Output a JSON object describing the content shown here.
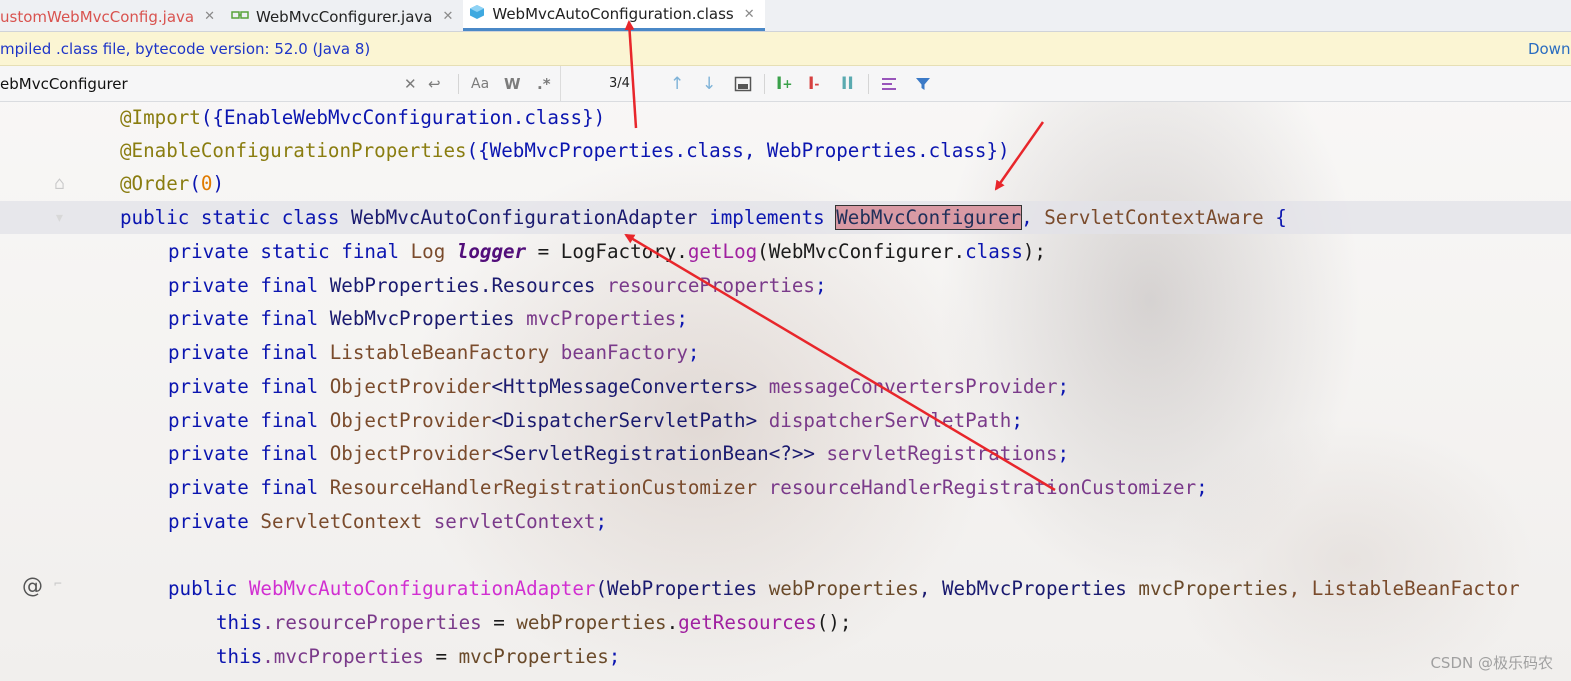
{
  "tabs": [
    {
      "label": "ustomWebMvcConfig.java",
      "color": "#d9534f",
      "icon": "java-file-icon",
      "active": false
    },
    {
      "label": "WebMvcConfigurer.java",
      "color": "#222222",
      "icon": "interface-file-icon",
      "active": false
    },
    {
      "label": "WebMvcAutoConfiguration.class",
      "color": "#222222",
      "icon": "class-file-icon",
      "active": true
    }
  ],
  "tab_close_glyph": "✕",
  "banner": {
    "message": "mpiled .class file, bytecode version: 52.0 (Java 8)",
    "download_label": "Downloa"
  },
  "search": {
    "query": "ebMvcConfigurer",
    "match_case": "Aa",
    "words": "W",
    "regex": ".*",
    "match_count": "3/4"
  },
  "code": {
    "l1_import": "@Import",
    "l1_args": "({EnableWebMvcConfiguration.",
    "l1_class": "class",
    "l1_end": "})",
    "l2_ann": "@EnableConfigurationProperties",
    "l2_a": "({WebMvcProperties.",
    "l2_class1": "class",
    "l2_b": ", WebProperties.",
    "l2_class2": "class",
    "l2_end": "})",
    "l3_ann": "@Order",
    "l3_num": "0",
    "l4_mods": "public static class ",
    "l4_name": "WebMvcAutoConfigurationAdapter",
    "l4_impl": " implements ",
    "l4_iface": "WebMvcConfigurer",
    "l4_comma": ", ",
    "l4_iface2": "ServletContextAware",
    "l4_brace": " {",
    "f1_mods": "private static final ",
    "f1_type": "Log",
    "f1_name": "logger",
    "f1_eq": " = LogFactory.",
    "f1_mth": "getLog",
    "f1_arg": "(WebMvcConfigurer.",
    "f1_cls": "class",
    "f1_end": ");",
    "f2_mods": "private final ",
    "f2_type": "WebProperties.Resources",
    "f2_name": "resourceProperties",
    "f3_mods": "private final ",
    "f3_type": "WebMvcProperties",
    "f3_name": "mvcProperties",
    "f4_mods": "private final ",
    "f4_type": "ListableBeanFactory",
    "f4_name": "beanFactory",
    "f5_mods": "private final ",
    "f5_type": "ObjectProvider",
    "f5_gen": "<HttpMessageConverters>",
    "f5_name": "messageConvertersProvider",
    "f6_mods": "private final ",
    "f6_type": "ObjectProvider",
    "f6_gen": "<DispatcherServletPath>",
    "f6_name": "dispatcherServletPath",
    "f7_mods": "private final ",
    "f7_type": "ObjectProvider",
    "f7_gen": "<ServletRegistrationBean<?>>",
    "f7_name": "servletRegistrations",
    "f8_mods": "private final ",
    "f8_type": "ResourceHandlerRegistrationCustomizer",
    "f8_name": "resourceHandlerRegistrationCustomizer",
    "f9_mods": "private ",
    "f9_type": "ServletContext",
    "f9_name": "servletContext",
    "semi": ";",
    "c_mods": "public ",
    "c_name": "WebMvcAutoConfigurationAdapter",
    "c_p1t": "(WebProperties ",
    "c_p1n": "webProperties",
    "c_p2t": ", WebMvcProperties ",
    "c_p2n": "mvcProperties",
    "c_p3t": ", ListableBeanFactor",
    "b1_this": "this",
    "b1_fld": ".resourceProperties",
    "b1_eq": " = ",
    "b1_val": "webProperties",
    "b1_mth": "getResources",
    "b1_end": "();",
    "b2_this": "this",
    "b2_fld": ".mvcProperties",
    "b2_eq": " = ",
    "b2_val": "mvcProperties",
    "at_glyph": "@"
  },
  "watermark": "CSDN @极乐码农",
  "annotation_color": "#e8262b"
}
